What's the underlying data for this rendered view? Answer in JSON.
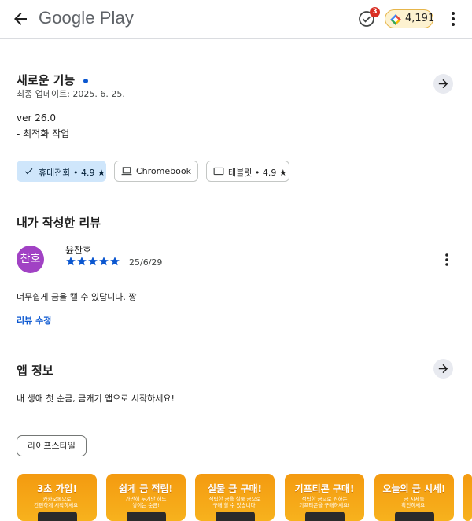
{
  "header": {
    "app_title": "Google Play",
    "tasks_badge_count": "3",
    "points_value": "4,191"
  },
  "whats_new": {
    "title": "새로운 기능",
    "updated": "최종 업데이트: 2025. 6. 25.",
    "version": "ver 26.0",
    "notes": "- 최적화 작업"
  },
  "device_chips": [
    {
      "label": "휴대전화 • 4.9 ★",
      "selected": true
    },
    {
      "label": "Chromebook",
      "selected": false
    },
    {
      "label": "태블릿 • 4.9 ★",
      "selected": false
    }
  ],
  "my_review": {
    "title": "내가 작성한 리뷰",
    "avatar_text": "찬호",
    "author": "윤찬호",
    "rating": 5,
    "date": "25/6/29",
    "text": "너무쉽게 금을 캘 수 있답니다. 짱",
    "edit_label": "리뷰 수정"
  },
  "app_info": {
    "title": "앱 정보",
    "description": "내 생애 첫 순금, 금캐기 앱으로 시작하세요!",
    "category_tag": "라이프스타일"
  },
  "screenshots": [
    {
      "title": "3초 가입!",
      "subtitle": "카카오톡으로\n간편하게 시작하세요!"
    },
    {
      "title": "쉽게 금 적립!",
      "subtitle": "가만히 두기만 해도\n쌓이는 순금!"
    },
    {
      "title": "실물 금 구매!",
      "subtitle": "적립한 금을 실물 금으로\n구매 할 수 있습니다."
    },
    {
      "title": "기프티콘 구매!",
      "subtitle": "적립한 금으로 원하는\n기프티콘을 구매하세요!"
    },
    {
      "title": "오늘의 금 시세!",
      "subtitle": "금 시세를\n확인하세요!"
    }
  ],
  "colors": {
    "accent_blue": "#0b57d0",
    "selected_chip_bg": "#cfe6fb",
    "avatar_purple": "#a142c4",
    "badge_red": "#d93025",
    "screenshot_orange": "#f49a10"
  },
  "icons": [
    "back-arrow-icon",
    "tasks-check-icon",
    "play-points-gem-icon",
    "more-vert-icon",
    "arrow-forward-icon",
    "check-icon",
    "laptop-icon",
    "tablet-icon",
    "star-icon"
  ]
}
